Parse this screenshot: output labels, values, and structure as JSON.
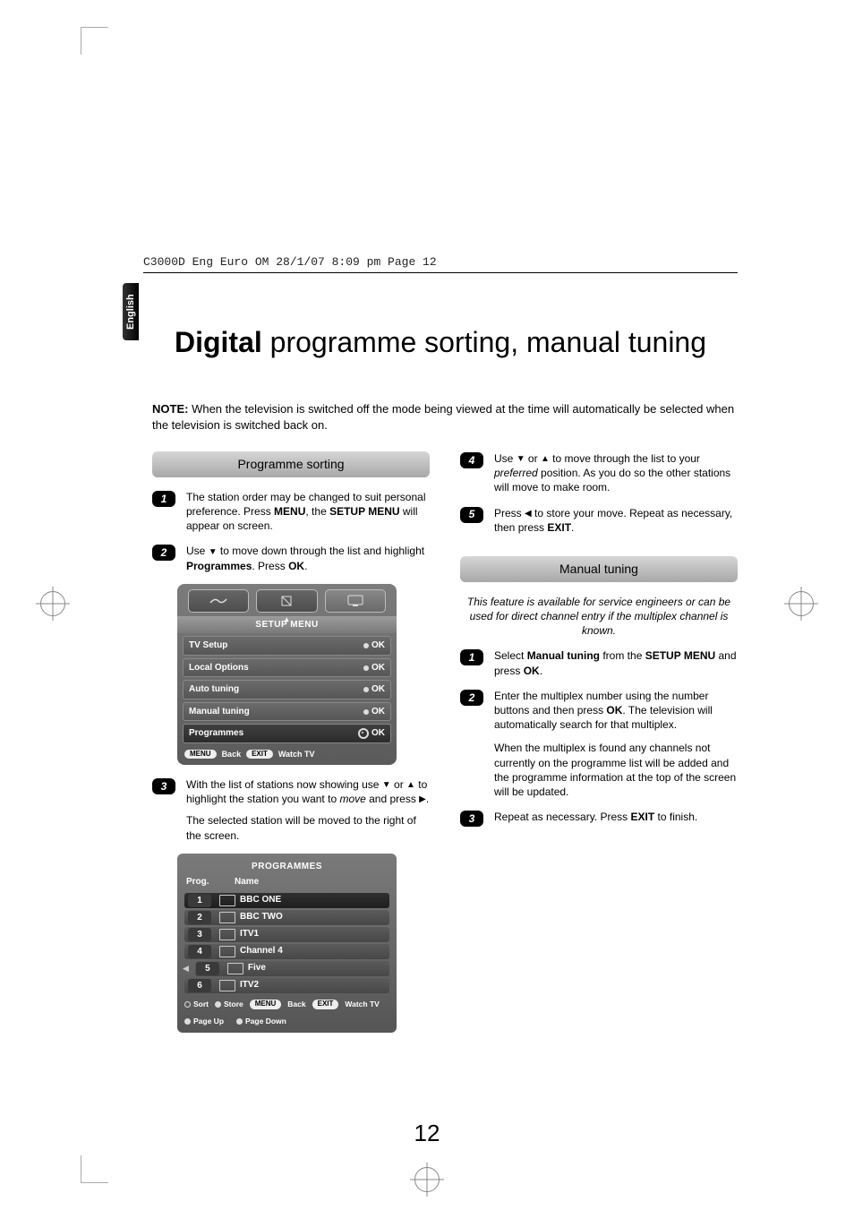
{
  "header": "C3000D Eng Euro OM  28/1/07  8:09 pm  Page 12",
  "side_tab": "English",
  "title_bold": "Digital",
  "title_rest": " programme sorting, manual tuning",
  "note_label": "NOTE:",
  "note_body": " When the television is switched off the mode being viewed at the time will automatically be selected when the television is switched back on.",
  "sec_prog": "Programme sorting",
  "sec_manual": "Manual tuning",
  "left": {
    "s1a": "The station order may be changed to suit personal preference. Press ",
    "s1b": ", the ",
    "s1c": " will appear on screen.",
    "menu": "MENU",
    "setup_menu": "SETUP MENU",
    "s2a": "Use ",
    "s2b": " to move down through the list and highlight ",
    "s2c": ". Press ",
    "s2d": ".",
    "programmes": "Programmes",
    "ok": "OK",
    "s3a": "With the list of stations now showing use ",
    "s3b": " or ",
    "s3c": " to highlight the station you want to ",
    "s3d": " and press ",
    "s3e": ".",
    "move_i": "move",
    "s3f": "The selected station will be moved to the right of the screen."
  },
  "right": {
    "s4a": "Use ",
    "s4b": " or ",
    "s4c": " to move through the list to your ",
    "s4d": " position. As you do so the other stations will move to make room.",
    "preferred_i": "preferred",
    "s5a": "Press ",
    "s5b": " to store your move. Repeat as necessary, then press ",
    "s5c": ".",
    "exit": "EXIT",
    "intro": "This feature is available for service engineers or can be used for direct channel entry if the multiplex channel is known.",
    "m1a": "Select ",
    "m1b": " from the ",
    "m1c": " and press ",
    "m1d": ".",
    "manual_tuning": "Manual tuning",
    "setup_menu": "SETUP MENU",
    "ok": "OK",
    "m2a": "Enter the multiplex number using the number buttons and then press ",
    "m2b": ". The television will automatically search for that multiplex.",
    "m2c": "When the multiplex is found any channels not currently on the programme list will be added and the programme information at the top of the screen will be updated.",
    "m3a": "Repeat as necessary. Press ",
    "m3b": " to finish."
  },
  "osd": {
    "title": "SETUP MENU",
    "rows": [
      "TV Setup",
      "Local Options",
      "Auto tuning",
      "Manual tuning",
      "Programmes"
    ],
    "ok": "OK",
    "btn_menu": "MENU",
    "back": "Back",
    "btn_exit": "EXIT",
    "watch": "Watch TV"
  },
  "prog": {
    "title": "PROGRAMMES",
    "h1": "Prog.",
    "h2": "Name",
    "rows": [
      {
        "n": "1",
        "name": "BBC ONE"
      },
      {
        "n": "2",
        "name": "BBC TWO"
      },
      {
        "n": "3",
        "name": "ITV1"
      },
      {
        "n": "4",
        "name": "Channel 4"
      },
      {
        "n": "5",
        "name": "Five"
      },
      {
        "n": "6",
        "name": "ITV2"
      }
    ],
    "sort": "Sort",
    "store": "Store",
    "menu": "MENU",
    "back": "Back",
    "exit": "EXIT",
    "watch": "Watch TV",
    "pu": "Page Up",
    "pd": "Page Down"
  },
  "page_number": "12"
}
